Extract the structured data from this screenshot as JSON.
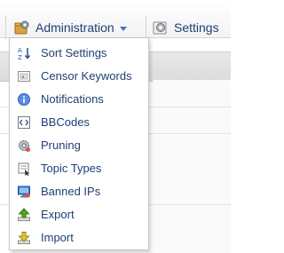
{
  "toolbar": {
    "administration_label": "Administration",
    "settings_label": "Settings"
  },
  "menu": {
    "items": [
      {
        "label": "Sort Settings",
        "icon": "sort-az-icon"
      },
      {
        "label": "Censor Keywords",
        "icon": "censor-icon"
      },
      {
        "label": "Notifications",
        "icon": "info-icon"
      },
      {
        "label": "BBCodes",
        "icon": "code-icon"
      },
      {
        "label": "Pruning",
        "icon": "gear-icon"
      },
      {
        "label": "Topic Types",
        "icon": "topic-types-icon"
      },
      {
        "label": "Banned IPs",
        "icon": "banned-ip-icon"
      },
      {
        "label": "Export",
        "icon": "export-arrow-icon"
      },
      {
        "label": "Import",
        "icon": "import-arrow-icon"
      }
    ]
  },
  "colors": {
    "link": "#1f3f73",
    "caret": "#3a76c2",
    "export": "#4aa81c",
    "import": "#4aa81c"
  }
}
